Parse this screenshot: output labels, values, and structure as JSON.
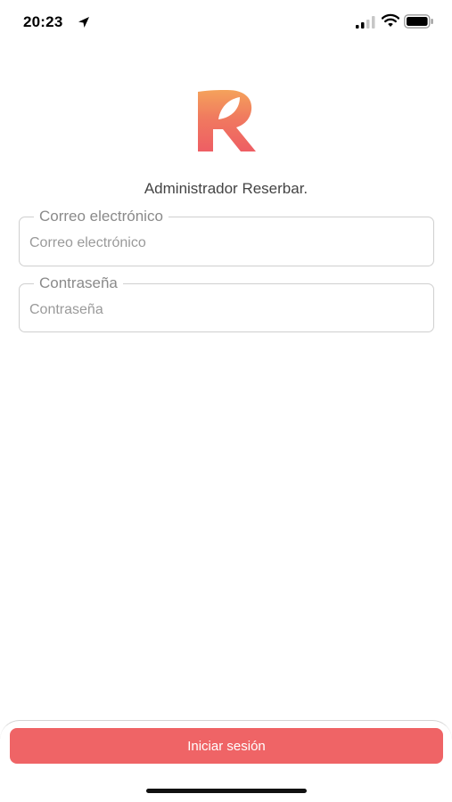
{
  "status_bar": {
    "time": "20:23",
    "icons": [
      "location-arrow-icon",
      "cellular-signal-icon",
      "wifi-icon",
      "battery-icon"
    ]
  },
  "brand": {
    "logo_icon": "reserbar-logo",
    "title": "Administrador Reserbar.",
    "colors": {
      "accent": "#ef6466",
      "logo_top": "#f5a25b",
      "logo_bottom": "#ee5e64"
    }
  },
  "form": {
    "email": {
      "label": "Correo electrónico",
      "placeholder": "Correo electrónico",
      "value": ""
    },
    "password": {
      "label": "Contraseña",
      "placeholder": "Contraseña",
      "value": ""
    }
  },
  "actions": {
    "login_label": "Iniciar sesión"
  }
}
